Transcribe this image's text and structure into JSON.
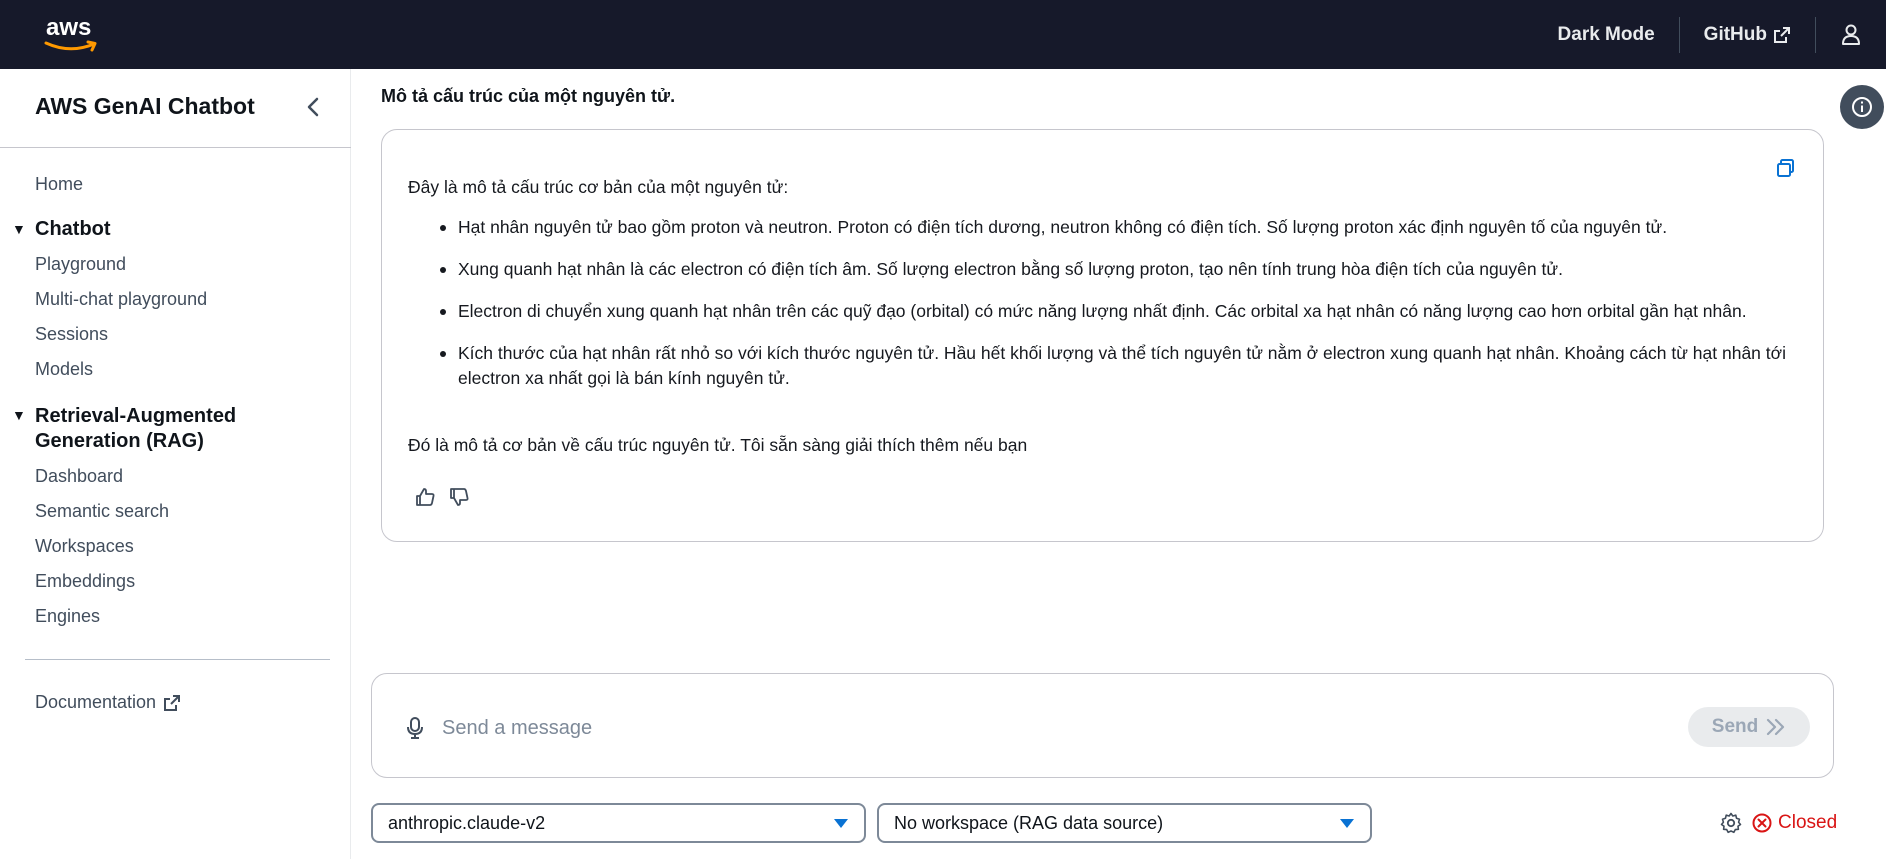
{
  "topnav": {
    "logo_text": "aws",
    "dark_mode_label": "Dark Mode",
    "github_label": "GitHub"
  },
  "sidebar": {
    "title": "AWS GenAI Chatbot",
    "home": "Home",
    "chatbot_section": "Chatbot",
    "chatbot_items": [
      "Playground",
      "Multi-chat playground",
      "Sessions",
      "Models"
    ],
    "rag_section_line1": "Retrieval-Augmented",
    "rag_section_line2": "Generation (RAG)",
    "rag_items": [
      "Dashboard",
      "Semantic search",
      "Workspaces",
      "Embeddings",
      "Engines"
    ],
    "documentation": "Documentation"
  },
  "chat": {
    "question": "Mô tả cấu trúc của một nguyên tử.",
    "answer_intro": "Đây là mô tả cấu trúc cơ bản của một nguyên tử:",
    "answer_items": [
      "Hạt nhân nguyên tử bao gồm proton và neutron. Proton có điện tích dương, neutron không có điện tích. Số lượng proton xác định nguyên tố của nguyên tử.",
      "Xung quanh hạt nhân là các electron có điện tích âm. Số lượng electron bằng số lượng proton, tạo nên tính trung hòa điện tích của nguyên tử.",
      "Electron di chuyển xung quanh hạt nhân trên các quỹ đạo (orbital) có mức năng lượng nhất định. Các orbital xa hạt nhân có năng lượng cao hơn orbital gần hạt nhân.",
      "Kích thước của hạt nhân rất nhỏ so với kích thước nguyên tử. Hầu hết khối lượng và thể tích nguyên tử nằm ở electron xung quanh hạt nhân. Khoảng cách từ hạt nhân tới electron xa nhất gọi là bán kính nguyên tử."
    ],
    "answer_outro": "Đó là mô tả cơ bản về cấu trúc nguyên tử. Tôi sẵn sàng giải thích thêm nếu bạn"
  },
  "composer": {
    "placeholder": "Send a message",
    "value": "",
    "send_label": "Send"
  },
  "controls": {
    "model_select": "anthropic.claude-v2",
    "workspace_select": "No workspace (RAG data source)",
    "connection_status": "Closed"
  },
  "colors": {
    "topnav_bg": "#16192a",
    "accent": "#0972d3",
    "error": "#d91515"
  }
}
